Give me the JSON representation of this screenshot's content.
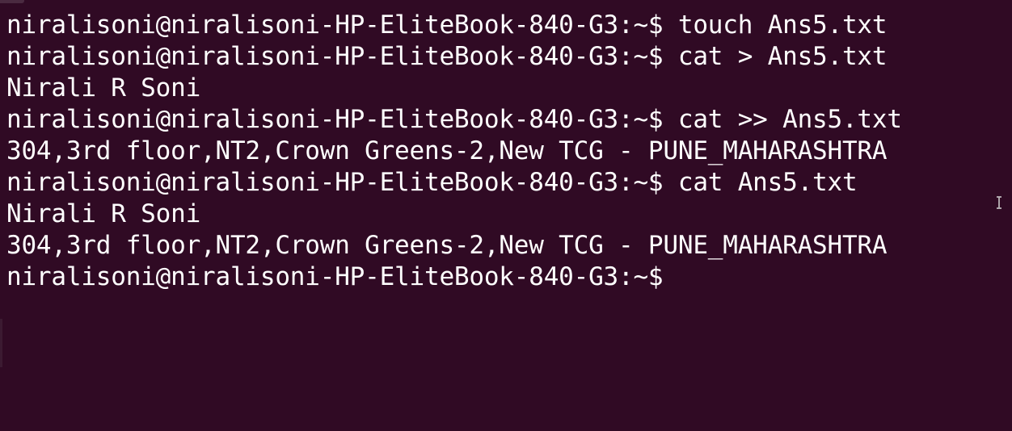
{
  "terminal": {
    "lines": [
      "niralisoni@niralisoni-HP-EliteBook-840-G3:~$ touch Ans5.txt",
      "niralisoni@niralisoni-HP-EliteBook-840-G3:~$ cat > Ans5.txt",
      "Nirali R Soni",
      "niralisoni@niralisoni-HP-EliteBook-840-G3:~$ cat >> Ans5.txt",
      "304,3rd floor,NT2,Crown Greens-2,New TCG - PUNE_MAHARASHTRA",
      "niralisoni@niralisoni-HP-EliteBook-840-G3:~$ cat Ans5.txt",
      "Nirali R Soni",
      "304,3rd floor,NT2,Crown Greens-2,New TCG - PUNE_MAHARASHTRA",
      "niralisoni@niralisoni-HP-EliteBook-840-G3:~$"
    ],
    "background_color": "#300a24",
    "text_color": "#ffffff",
    "mouse_cursor_icon": "text-ibeam-cursor-icon"
  }
}
